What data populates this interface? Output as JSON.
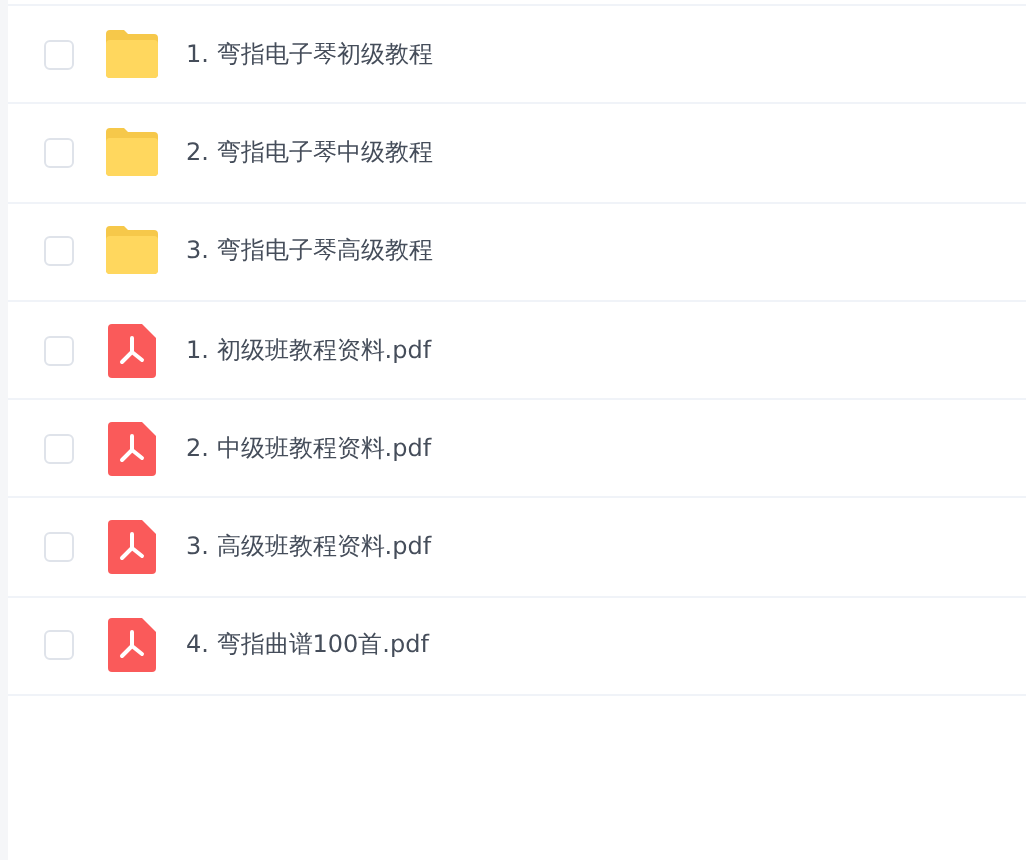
{
  "files": [
    {
      "kind": "folder",
      "name": "1. 弯指电子琴初级教程",
      "checked": false
    },
    {
      "kind": "folder",
      "name": "2. 弯指电子琴中级教程",
      "checked": false
    },
    {
      "kind": "folder",
      "name": "3. 弯指电子琴高级教程",
      "checked": false
    },
    {
      "kind": "pdf",
      "name": "1. 初级班教程资料.pdf",
      "checked": false
    },
    {
      "kind": "pdf",
      "name": "2. 中级班教程资料.pdf",
      "checked": false
    },
    {
      "kind": "pdf",
      "name": "3. 高级班教程资料.pdf",
      "checked": false
    },
    {
      "kind": "pdf",
      "name": "4. 弯指曲谱100首.pdf",
      "checked": false
    }
  ]
}
